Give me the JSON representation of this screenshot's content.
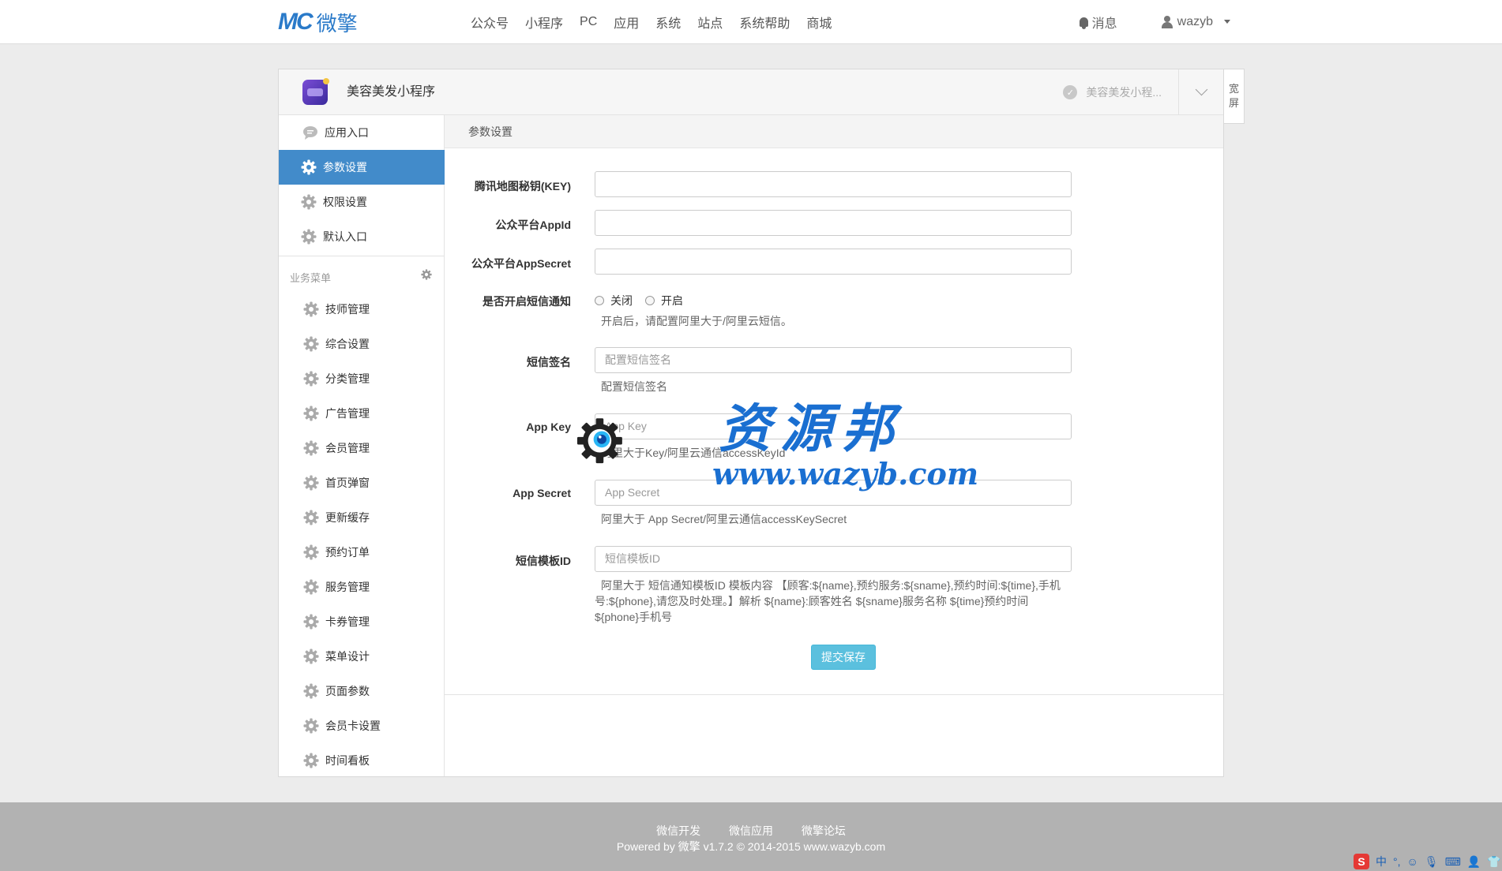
{
  "brand": {
    "logo_mark": "MC",
    "logo_text": "微擎"
  },
  "nav": [
    "公众号",
    "小程序",
    "PC",
    "应用",
    "系统",
    "站点",
    "系统帮助",
    "商城"
  ],
  "topright": {
    "messages": "消息",
    "username": "wazyb"
  },
  "app": {
    "title": "美容美发小程序",
    "switch_label": "美容美发小程...",
    "wide_label_1": "宽",
    "wide_label_2": "屏"
  },
  "sidebar": {
    "top_items": [
      {
        "label": "应用入口",
        "icon": "comment-icon"
      },
      {
        "label": "参数设置",
        "icon": "gear-icon",
        "active": true
      },
      {
        "label": "权限设置",
        "icon": "gear-icon"
      },
      {
        "label": "默认入口",
        "icon": "gear-icon"
      }
    ],
    "group_title": "业务菜单",
    "group_items": [
      "技师管理",
      "综合设置",
      "分类管理",
      "广告管理",
      "会员管理",
      "首页弹窗",
      "更新缓存",
      "预约订单",
      "服务管理",
      "卡券管理",
      "菜单设计",
      "页面参数",
      "会员卡设置",
      "时间看板"
    ]
  },
  "content": {
    "header": "参数设置",
    "fields": {
      "map_key_label": "腾讯地图秘钥(KEY)",
      "mp_appid_label": "公众平台AppId",
      "mp_secret_label": "公众平台AppSecret",
      "sms_switch_label": "是否开启短信通知",
      "sms_off": "关闭",
      "sms_on": "开启",
      "sms_help": "开启后，请配置阿里大于/阿里云短信。",
      "sign_label": "短信签名",
      "sign_placeholder": "配置短信签名",
      "sign_help": "配置短信签名",
      "appkey_label": "App Key",
      "appkey_placeholder": "App Key",
      "appkey_help": "阿里大于Key/阿里云通信accessKeyId",
      "appsecret_label": "App Secret",
      "appsecret_placeholder": "App Secret",
      "appsecret_help": "阿里大于 App Secret/阿里云通信accessKeySecret",
      "tpl_label": "短信模板ID",
      "tpl_placeholder": "短信模板ID",
      "tpl_help_1": "阿里大于 短信通知模板ID 模板内容 【顾客:${name},预约服务:${sname},预约时间:${time},手机",
      "tpl_help_2": "号:${phone},请您及时处理。】解析 ${name}:顾客姓名 ${sname}服务名称 ${time}预约时间",
      "tpl_help_3": "${phone}手机号"
    },
    "submit": "提交保存"
  },
  "footer": {
    "links": [
      "微信开发",
      "微信应用",
      "微擎论坛"
    ],
    "copyright": "Powered by 微擎 v1.7.2 © 2014-2015 www.wazyb.com"
  },
  "watermark": {
    "cn": "资源邦",
    "url": "www.wazyb.com"
  },
  "ime": {
    "mode": "中"
  },
  "colors": {
    "accent": "#428bca",
    "submit": "#5bc0de",
    "footer": "#b2b2b2",
    "watermark": "#1a6fd1"
  }
}
